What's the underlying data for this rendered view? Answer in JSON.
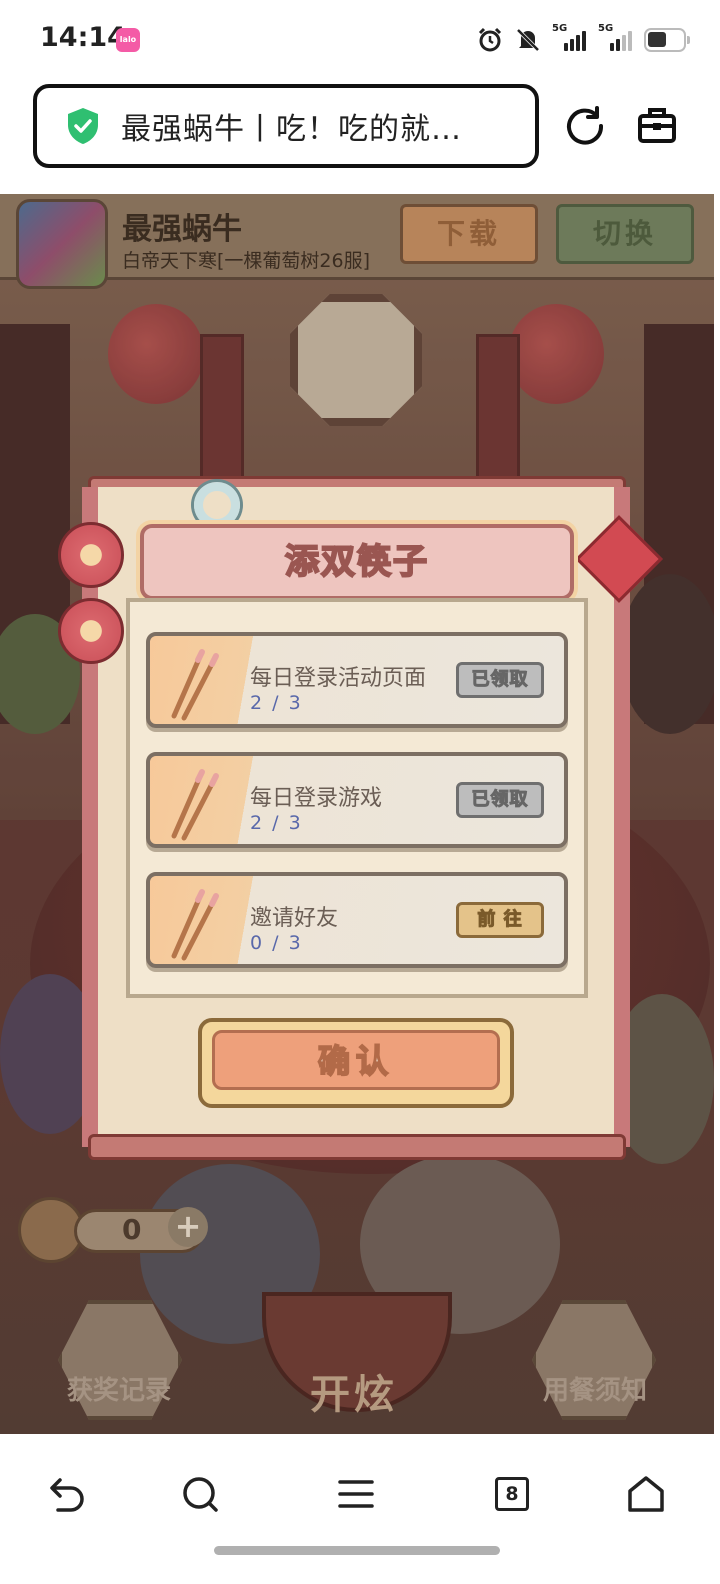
{
  "status_bar": {
    "time": "14:14",
    "app_badge": "lalo",
    "signal1_label": "5G",
    "signal2_label": "5G",
    "icons": [
      "alarm-icon",
      "mute-icon",
      "signal-icon",
      "signal-icon",
      "battery-icon"
    ]
  },
  "browser": {
    "url_title": "最强蜗牛丨吃！吃的就…",
    "secure_icon": "shield-check-icon",
    "reload_icon": "reload-icon",
    "toolbox_icon": "toolbox-icon"
  },
  "game_header": {
    "title": "最强蜗牛",
    "subtitle": "白帝天下寒[一棵葡萄树26服]",
    "download_label": "下载",
    "switch_label": "切换"
  },
  "background_labels": {
    "chopsticks_count": "0",
    "rewards_label": "获奖记录",
    "start_label": "开炫",
    "dining_rules_label": "用餐须知"
  },
  "dialog": {
    "title": "添双筷子",
    "tasks": [
      {
        "name": "每日登录活动页面",
        "progress": "2 / 3",
        "button": "已领取",
        "state": "claimed"
      },
      {
        "name": "每日登录游戏",
        "progress": "2 / 3",
        "button": "已领取",
        "state": "claimed"
      },
      {
        "name": "邀请好友",
        "progress": "0 / 3",
        "button": "前 往",
        "state": "go"
      }
    ],
    "confirm_label": "确认"
  },
  "nav": {
    "tab_count": "8",
    "icons": [
      "back-icon",
      "search-icon",
      "menu-icon",
      "tabs-icon",
      "home-icon"
    ]
  },
  "colors": {
    "dialog_frame": "#c8797a",
    "dialog_paper": "#eedfc6",
    "progress_text": "#5968aa",
    "shield_green": "#2fbf71"
  }
}
